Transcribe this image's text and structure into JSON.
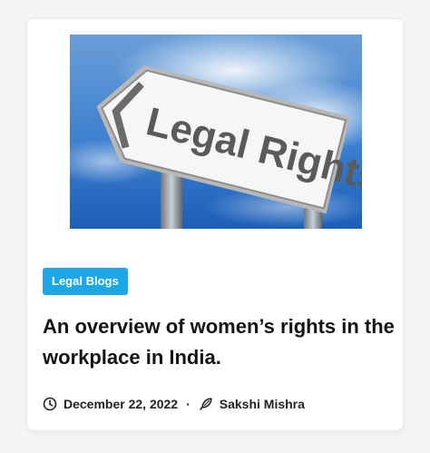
{
  "post": {
    "image_text": "Legal Rights",
    "category": "Legal Blogs",
    "title": "An overview of women’s rights in the workplace in India.",
    "date": "December 22, 2022",
    "separator": "·",
    "author": "Sakshi Mishra"
  },
  "icons": {
    "date": "clock-icon",
    "author": "feather-pen-icon"
  },
  "colors": {
    "accent": "#1ea7e4",
    "title": "#141414",
    "card_background": "#ffffff",
    "page_background": "#f4f5f7"
  }
}
